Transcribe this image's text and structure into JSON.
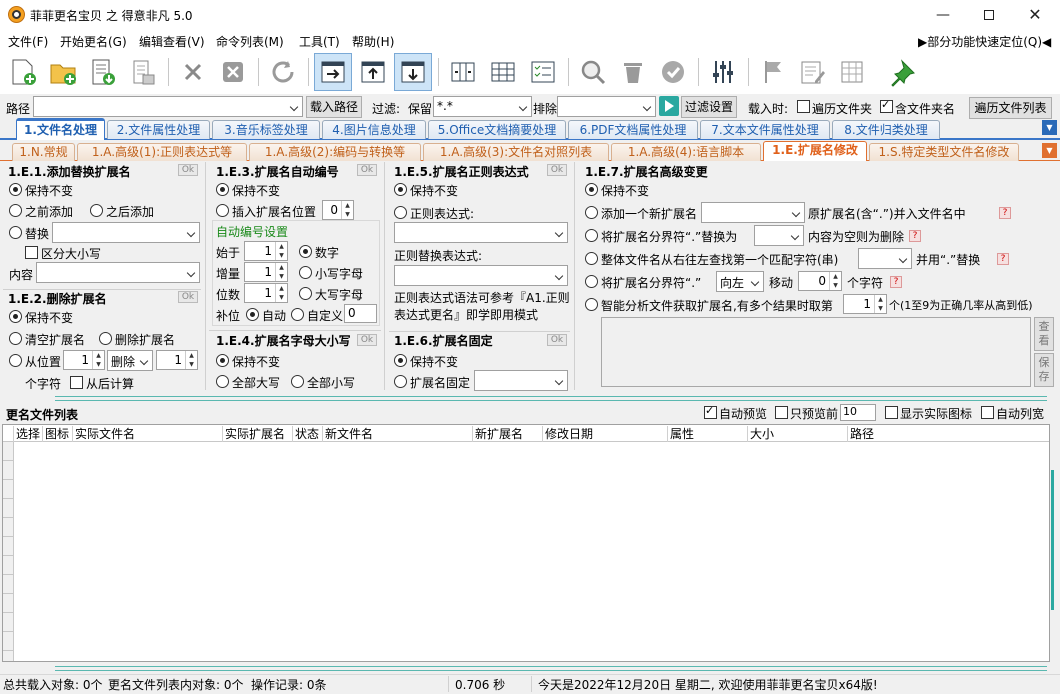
{
  "window": {
    "title": "菲菲更名宝贝 之 得意非凡 5.0"
  },
  "menu": {
    "items": [
      "文件(F)",
      "开始更名(G)",
      "编辑查看(V)",
      "命令列表(M)",
      "工具(T)",
      "帮助(H)"
    ],
    "quick_locate": "▶部分功能快速定位(Q)◀"
  },
  "path_bar": {
    "path_label": "路径",
    "path_value": "",
    "load_path_button": "载入路径",
    "filter_label": "过滤:",
    "keep_label": "保留",
    "keep_value": "*.*",
    "exclude_label": "排除",
    "exclude_value": "",
    "filter_settings_button": "过滤设置",
    "on_load_label": "载入时:",
    "traverse_folders_label": "遍历文件夹",
    "include_folder_name_label": "含文件夹名",
    "traverse_file_list_button": "遍历文件列表"
  },
  "main_tabs": [
    "1.文件名处理",
    "2.文件属性处理",
    "3.音乐标签处理",
    "4.图片信息处理",
    "5.Office文档摘要处理",
    "6.PDF文档属性处理",
    "7.文本文件属性处理",
    "8.文件归类处理"
  ],
  "sub_tabs": [
    "1.N.常规",
    "1.A.高级(1):正则表达式等",
    "1.A.高级(2):编码与转换等",
    "1.A.高级(3):文件名对照列表",
    "1.A.高级(4):语言脚本",
    "1.E.扩展名修改",
    "1.S.特定类型文件名修改"
  ],
  "ok_label": "Ok",
  "panel_e1": {
    "title": "1.E.1.添加替换扩展名",
    "keep": "保持不变",
    "add_before": "之前添加",
    "add_after": "之后添加",
    "replace": "替换",
    "replace_value": "",
    "case_sensitive": "区分大小写",
    "content_label": "内容",
    "content_value": ""
  },
  "panel_e2": {
    "title": "1.E.2.删除扩展名",
    "keep": "保持不变",
    "clear_ext": "清空扩展名",
    "delete_ext": "删除扩展名",
    "from_pos": "从位置",
    "from_pos_value": "1",
    "delete_label": "删除",
    "delete_count": "1",
    "chars_label": "个字符",
    "from_end": "从后计算"
  },
  "panel_e3": {
    "title": "1.E.3.扩展名自动编号",
    "keep": "保持不变",
    "insert_at": "插入扩展名位置",
    "insert_value": "0",
    "auto_settings": "自动编号设置",
    "start_label": "始于",
    "start_value": "1",
    "step_label": "增量",
    "step_value": "1",
    "digits_label": "位数",
    "digits_value": "1",
    "digit_mode": "数字",
    "lower_mode": "小写字母",
    "upper_mode": "大写字母",
    "pad_label": "补位",
    "pad_auto": "自动",
    "pad_custom": "自定义",
    "pad_value": "0"
  },
  "panel_e4": {
    "title": "1.E.4.扩展名字母大小写",
    "keep": "保持不变",
    "all_upper": "全部大写",
    "all_lower": "全部小写"
  },
  "panel_e5": {
    "title": "1.E.5.扩展名正则表达式",
    "keep": "保持不变",
    "regex_label": "正则表达式:",
    "regex_value": "",
    "regex_replace_label": "正则替换表达式:",
    "regex_replace_value": "",
    "hint": "正则表达式语法可参考『A1.正则表达式更名』即学即用模式"
  },
  "panel_e6": {
    "title": "1.E.6.扩展名固定",
    "keep": "保持不变",
    "fixed": "扩展名固定",
    "fixed_value": ""
  },
  "panel_e7": {
    "title": "1.E.7.扩展名高级变更",
    "keep": "保持不变",
    "add_new": "添加一个新扩展名",
    "add_new_value": "",
    "add_new_suffix": "原扩展名(含“.”)并入文件名中",
    "replace_sep": "将扩展名分界符“.”替换为",
    "replace_sep_value": "",
    "replace_sep_suffix": "内容为空则为删除",
    "whole_name": "整体文件名从右往左查找第一个匹配字符(串)",
    "whole_name_value": "",
    "whole_name_suffix": "并用“.”替换",
    "move_sep": "将扩展名分界符“.”",
    "move_dir": "向左",
    "move_label": "移动",
    "move_value": "0",
    "move_suffix": "个字符",
    "smart": "智能分析文件获取扩展名,有多个结果时取第",
    "smart_value": "1",
    "smart_suffix": "个(1至9为正确几率从高到低)",
    "help_mark": "?",
    "view_button": "查看",
    "save_button": "保存"
  },
  "file_list": {
    "title": "更名文件列表",
    "auto_preview": "自动预览",
    "preview_only": "只预览前",
    "preview_count": "10",
    "show_icons": "显示实际图标",
    "auto_width": "自动列宽",
    "columns": [
      "选择",
      "图标",
      "实际文件名",
      "实际扩展名",
      "状态",
      "新文件名",
      "新扩展名",
      "修改日期",
      "属性",
      "大小",
      "路径"
    ]
  },
  "status": {
    "total": "总共载入对象: 0个",
    "in_list": "更名文件列表内对象: 0个",
    "ops": "操作记录: 0条",
    "time": "0.706 秒",
    "message": "今天是2022年12月20日 星期二, 欢迎使用菲菲更名宝贝x64版!"
  },
  "colors": {
    "accent": "#1f5fb0",
    "sub_accent": "#e0601a",
    "tab_active_line": "#3a76c8"
  }
}
